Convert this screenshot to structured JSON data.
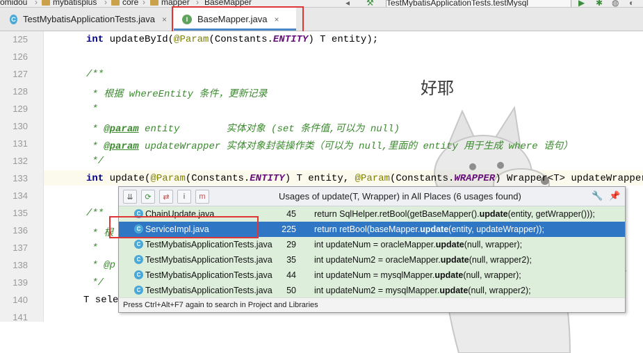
{
  "breadcrumb": {
    "items": [
      "omidou",
      "mybatisplus",
      "core",
      "mapper",
      "BaseMapper"
    ],
    "run_config": "TestMybatisApplicationTests.testMysql"
  },
  "tabs": [
    {
      "label": "TestMybatisApplicationTests.java",
      "close": "×",
      "icon": "class-icon"
    },
    {
      "label": "BaseMapper.java",
      "close": "×",
      "icon": "interface-icon"
    }
  ],
  "editor": {
    "line_numbers": [
      "125",
      "126",
      "127",
      "128",
      "129",
      "130",
      "131",
      "132",
      "133",
      "134",
      "135",
      "136",
      "137",
      "138",
      "139",
      "140",
      "141"
    ],
    "lines": {
      "l125": {
        "a": "int",
        "b": " updateById(",
        "c": "@Param",
        "d": "(Constants.",
        "e": "ENTITY",
        "f": ") T entity);"
      },
      "l127": "/**",
      "l128": " * 根据 whereEntity 条件，更新记录",
      "l129": " *",
      "l130": {
        "tag": "@param",
        "rest": " entity        实体对象 (set 条件值,可以为 null)"
      },
      "l131": {
        "tag": "@param",
        "rest": " updateWrapper 实体对象封装操作类（可以为 null,里面的 entity 用于生成 where 语句）"
      },
      "l132": " */",
      "l133": {
        "a": "int",
        "b": " update(",
        "c": "@Param",
        "d": "(Constants.",
        "e": "ENTITY",
        "f": ") T entity, ",
        "g": "@Param",
        "h": "(Constants.",
        "i": "WRAPPER",
        "j": ") Wrapper<T> updateWrapper);"
      },
      "l135": "/**",
      "l136": " * 根",
      "l137": " *",
      "l138": " * @p",
      "l139": " */",
      "l140": "T sele"
    }
  },
  "mascot": {
    "caption": "好耶"
  },
  "popup": {
    "title": "Usages of update(T, Wrapper) in All Places (6 usages found)",
    "footer": "Press Ctrl+Alt+F7 again to search in Project and Libraries",
    "rows": [
      {
        "file": "ChainUpdate.java",
        "line": "45",
        "pre": "return SqlHelper.retBool(getBaseMapper().",
        "hit": "update",
        "post": "(entity, getWrapper()));"
      },
      {
        "file": "ServiceImpl.java",
        "line": "225",
        "pre": "return retBool(baseMapper.",
        "hit": "update",
        "post": "(entity, updateWrapper));"
      },
      {
        "file": "TestMybatisApplicationTests.java",
        "line": "29",
        "pre": "int updateNum = oracleMapper.",
        "hit": "update",
        "post": "(null, wrapper);"
      },
      {
        "file": "TestMybatisApplicationTests.java",
        "line": "35",
        "pre": "int updateNum2 = oracleMapper.",
        "hit": "update",
        "post": "(null, wrapper2);"
      },
      {
        "file": "TestMybatisApplicationTests.java",
        "line": "44",
        "pre": "int updateNum = mysqlMapper.",
        "hit": "update",
        "post": "(null, wrapper);"
      },
      {
        "file": "TestMybatisApplicationTests.java",
        "line": "50",
        "pre": "int updateNum2 = mysqlMapper.",
        "hit": "update",
        "post": "(null, wrapper2);"
      }
    ]
  },
  "colors": {
    "selection": "#2f77c4",
    "row_bg": "#ddeedb",
    "annotation_box": "#e03535"
  }
}
